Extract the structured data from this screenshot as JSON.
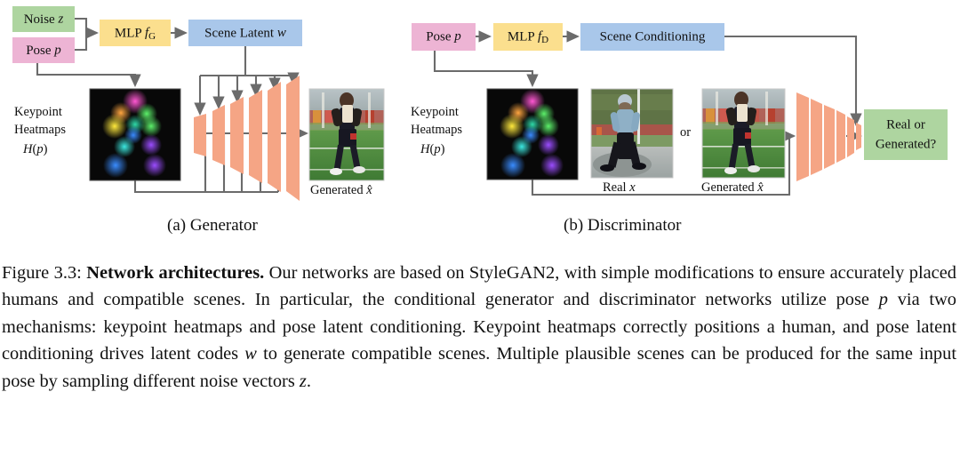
{
  "figure": {
    "panels": [
      {
        "id": "generator",
        "subcaption": "(a) Generator",
        "boxes": [
          {
            "name": "noise",
            "text": "Noise",
            "symbol": "z",
            "color": "#aed5a0"
          },
          {
            "name": "pose",
            "text": "Pose",
            "symbol": "p",
            "color": "#edb4d4"
          },
          {
            "name": "mlp",
            "text": "MLP",
            "symbol": "fG",
            "color": "#fbdf8e"
          },
          {
            "name": "scene-latent",
            "text": "Scene Latent",
            "symbol": "w",
            "color": "#a9c7ea"
          }
        ],
        "heatmap_label": [
          "Keypoint",
          "Heatmaps",
          "H(p)"
        ],
        "output_label": "Generated",
        "output_symbol": "x̂",
        "synthesis_blocks": 6
      },
      {
        "id": "discriminator",
        "subcaption": "(b) Discriminator",
        "boxes": [
          {
            "name": "pose",
            "text": "Pose",
            "symbol": "p",
            "color": "#edb4d4"
          },
          {
            "name": "mlp",
            "text": "MLP",
            "symbol": "fD",
            "color": "#fbdf8e"
          },
          {
            "name": "scene-conditioning",
            "text": "Scene Conditioning",
            "symbol": "",
            "color": "#a9c7ea"
          },
          {
            "name": "decision",
            "text": "Real or Generated?",
            "symbol": "",
            "color": "#aed5a0"
          }
        ],
        "heatmap_label": [
          "Keypoint",
          "Heatmaps",
          "H(p)"
        ],
        "real_label": "Real",
        "real_symbol": "x",
        "generated_label": "Generated",
        "generated_symbol": "x̂",
        "or_label": "or",
        "discriminator_blocks": 6
      }
    ]
  },
  "caption": {
    "number": "Figure 3.3:",
    "bold_title": "Network architectures.",
    "body_1": " Our networks are based on StyleGAN2, with simple modifications to ensure accurately placed humans and compatible scenes. In particular, the conditional generator and discriminator networks utilize pose ",
    "it_1": "p",
    "body_2": " via two mechanisms: keypoint heatmaps and pose latent conditioning. Keypoint heatmaps correctly positions a human, and pose latent conditioning drives latent codes ",
    "it_2": "w",
    "body_3": " to generate compatible scenes. Multiple plausible scenes can be produced for the same input pose by sampling different noise vectors ",
    "it_3": "z",
    "body_4": "."
  },
  "colors": {
    "green": "#aed5a0",
    "pink": "#edb4d4",
    "yellow": "#fbdf8e",
    "blue": "#a9c7ea",
    "orange": "#f5a585",
    "line": "#6b6b6b"
  }
}
